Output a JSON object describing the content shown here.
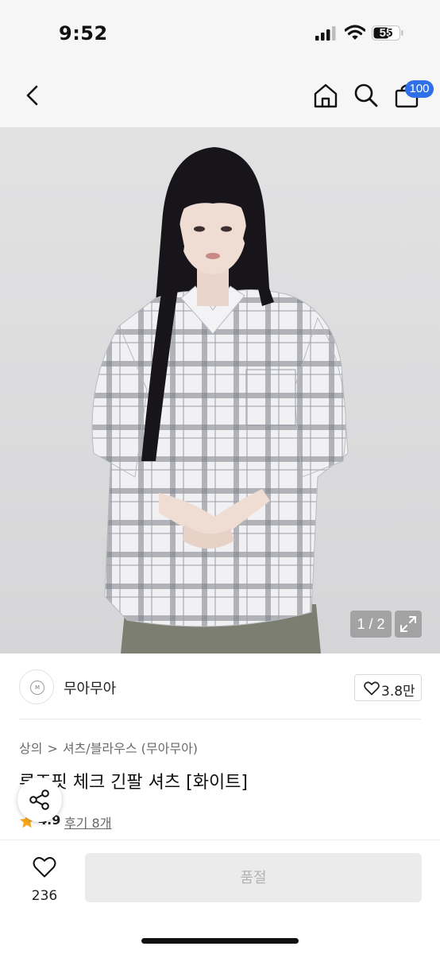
{
  "status_bar": {
    "time": "9:52",
    "battery_level": "55"
  },
  "nav": {
    "back_icon": "chevron-left-icon",
    "home_icon": "home-icon",
    "search_icon": "search-icon",
    "cart_icon": "shopping-bag-icon",
    "cart_badge": "100",
    "badge_color": "#2f6fe8"
  },
  "gallery": {
    "pager": "1 / 2",
    "expand_icon": "expand-icon"
  },
  "brand": {
    "name": "무아무아",
    "likes": "3.8만"
  },
  "product": {
    "breadcrumb": [
      "상의",
      "셔츠/블라우스",
      "(무아무아)"
    ],
    "title": "루즈핏 체크 긴팔 셔츠 [화이트]",
    "rating": "4.9",
    "review_label": "후기 8개",
    "star_color": "#f7a81b"
  },
  "bottom_bar": {
    "wish_count": "236",
    "buy_label": "품절"
  }
}
